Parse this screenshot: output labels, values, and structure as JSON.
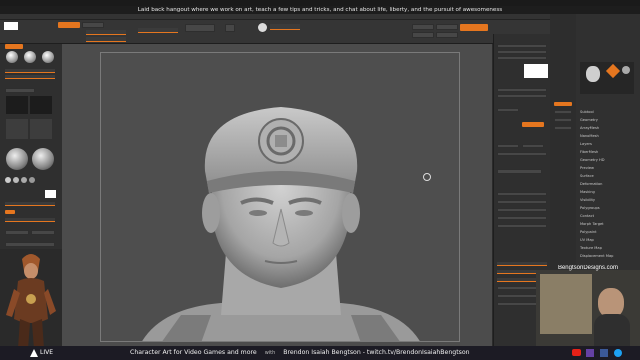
{
  "banner": {
    "text": "Laid back hangout where we work on art, teach a few tips and tricks, and chat about life, liberty, and the pursuit of awesomeness"
  },
  "watermark": "BengtsonDesigns.com",
  "footer": {
    "live_label": "LIVE",
    "message_left": "Character Art for Video Games and more",
    "message_with": "with",
    "message_right": "Brendon Isaiah Bengtson - twitch.tv/BrendonIsaiahBengtson"
  },
  "social_icons": [
    "youtube-icon",
    "twitch-icon",
    "facebook-icon",
    "twitter-icon"
  ],
  "colors": {
    "accent": "#e5761f",
    "canvas": "#4c4c4c",
    "panel": "#2f2f2f",
    "footer": "#1c1b24",
    "model": "#b9b9b9"
  },
  "right_menu": [
    "Subtool",
    "Geometry",
    "ArrayMesh",
    "NanoMesh",
    "Layers",
    "FiberMesh",
    "Geometry HD",
    "Preview",
    "Surface",
    "Deformation",
    "Masking",
    "Visibility",
    "Polygroups",
    "Contact",
    "Morph Target",
    "Polypaint",
    "UV Map",
    "Texture Map",
    "Displacement Map"
  ],
  "cursor_icon": "rotate-cursor-icon"
}
